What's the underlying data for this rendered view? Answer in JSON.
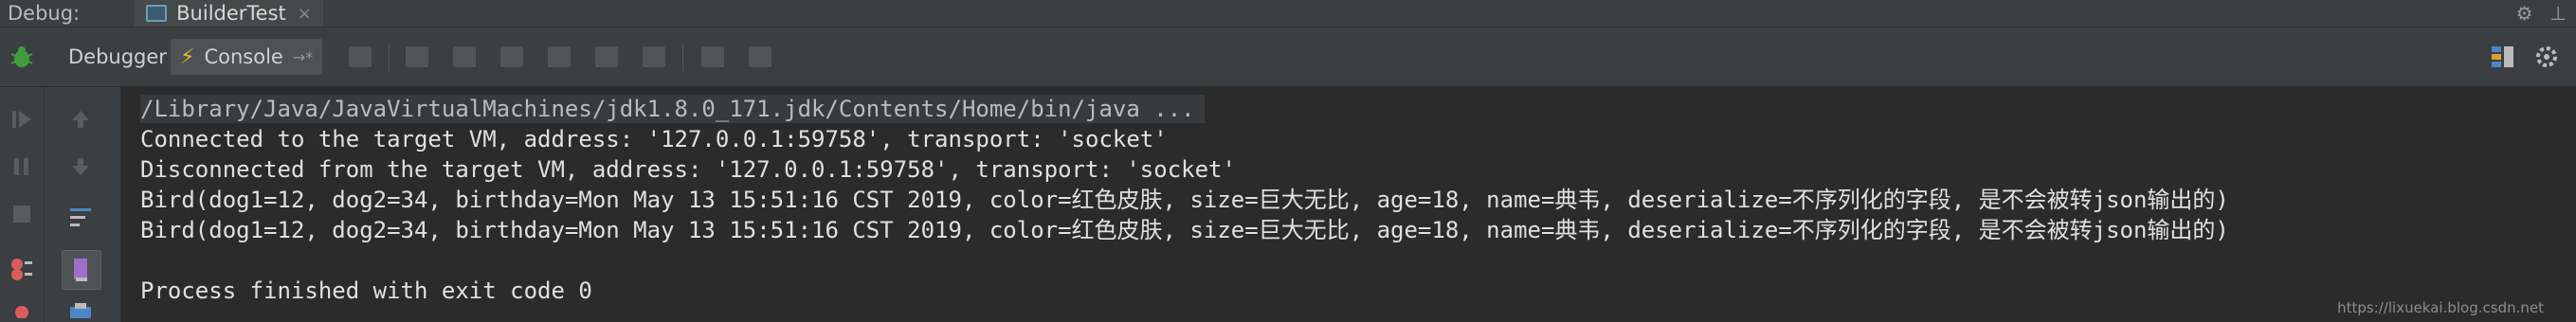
{
  "titlebar": {
    "label": "Debug:",
    "run_tab": "BuilderTest",
    "close": "×"
  },
  "toolbar": {
    "debugger_tab": "Debugger",
    "console_tab": "Console",
    "console_pin": "→*"
  },
  "console": {
    "lines": [
      "/Library/Java/JavaVirtualMachines/jdk1.8.0_171.jdk/Contents/Home/bin/java ...",
      "Connected to the target VM, address: '127.0.0.1:59758', transport: 'socket'",
      "Disconnected from the target VM, address: '127.0.0.1:59758', transport: 'socket'",
      "Bird(dog1=12, dog2=34, birthday=Mon May 13 15:51:16 CST 2019, color=红色皮肤, size=巨大无比, age=18, name=典韦, deserialize=不序列化的字段, 是不会被转json输出的)",
      "Bird(dog1=12, dog2=34, birthday=Mon May 13 15:51:16 CST 2019, color=红色皮肤, size=巨大无比, age=18, name=典韦, deserialize=不序列化的字段, 是不会被转json输出的)",
      "",
      "Process finished with exit code 0"
    ]
  },
  "watermark": "https://lixuekai.blog.csdn.net"
}
